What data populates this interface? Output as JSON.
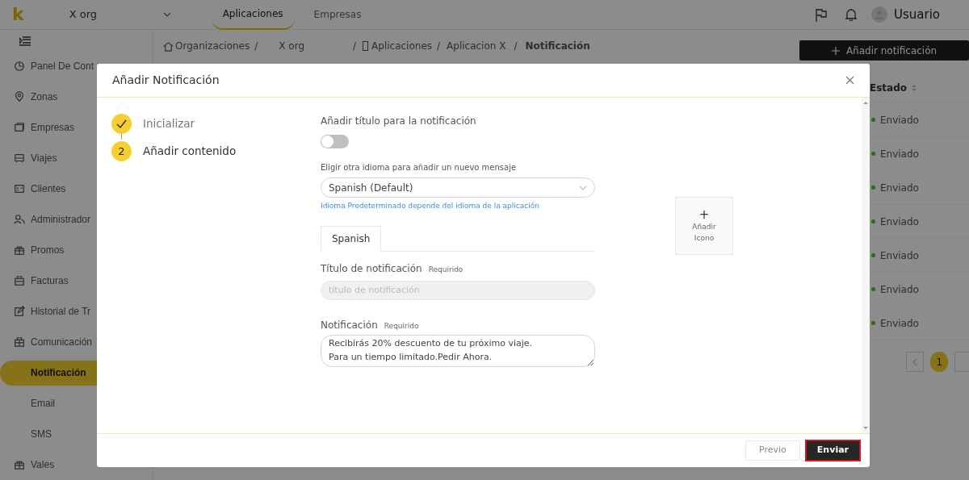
{
  "topbar": {
    "logo": "k",
    "org_select": "X org",
    "tabs": [
      {
        "label": "Aplicaciones",
        "selected": true
      },
      {
        "label": "Empresas",
        "selected": false
      }
    ],
    "user": "Usuario"
  },
  "sidebar": {
    "items": [
      {
        "label": "Panel De Cont",
        "selected": false
      },
      {
        "label": "Zonas",
        "selected": false
      },
      {
        "label": "Empresas",
        "selected": false
      },
      {
        "label": "Viajes",
        "selected": false
      },
      {
        "label": "Clientes",
        "selected": false
      },
      {
        "label": "Administrador",
        "selected": false
      },
      {
        "label": "Promos",
        "selected": false
      },
      {
        "label": "Facturas",
        "selected": false
      },
      {
        "label": "Historial de Tr",
        "selected": false
      },
      {
        "label": "Comunicación",
        "selected": false,
        "children": [
          {
            "label": "Notificación",
            "selected": true
          },
          {
            "label": "Email",
            "selected": false
          },
          {
            "label": "SMS",
            "selected": false
          }
        ]
      },
      {
        "label": "Vales",
        "selected": false
      }
    ]
  },
  "breadcrumb": [
    "Organizaciones",
    "/",
    "X org",
    "/",
    "Aplicaciones",
    "/",
    "Aplicacion X",
    "/",
    "Notificación"
  ],
  "add_button": "Añadir notificación",
  "table": {
    "columns": [
      "Estado"
    ],
    "rows": [
      {
        "status": "Enviado",
        "color": "#2d6c0e"
      },
      {
        "status": "Enviado",
        "color": "#2d6c0e"
      },
      {
        "status": "Enviado",
        "color": "#2d6c0e"
      },
      {
        "status": "Enviado",
        "color": "#2d6c0e"
      },
      {
        "status": "Enviado",
        "color": "#2d6c0e"
      },
      {
        "status": "Enviado",
        "color": "#2d6c0e"
      },
      {
        "status": "Enviado",
        "color": "#2d6c0e"
      }
    ]
  },
  "pagination": {
    "pages": [
      {
        "label": "1",
        "selected": true
      }
    ]
  },
  "modal": {
    "title": "Añadir Notificación",
    "steps": [
      {
        "label": "Inicializar",
        "completed": true
      },
      {
        "number": "2",
        "label": "Añadir contenido",
        "completed": false
      }
    ],
    "title_toggle": {
      "label": "Añadir título para la notificación",
      "on": false
    },
    "language": {
      "label": "Eligir otra idioma para añadir un nuevo mensaje",
      "value": "Spanish (Default)",
      "hint": "Idioma Predeterminado depende del idioma de la aplicación"
    },
    "language_tabs": [
      {
        "label": "Spanish",
        "selected": true
      }
    ],
    "title_field": {
      "label": "Título de notificación",
      "required": "Requirido",
      "placeholder": "título de notificación",
      "disabled": true
    },
    "message_field": {
      "label": "Notificación",
      "required": "Requirido",
      "value": "Recibirás 20% descuento de tu próximo viaje.\nPara un tiempo limitado.Pedir Ahora."
    },
    "icon_upload": {
      "plus": "+",
      "label": "Añadir Icono"
    },
    "buttons": [
      {
        "label": "Previo",
        "kind": "secondary"
      },
      {
        "label": "Enviar",
        "kind": "primary"
      }
    ]
  }
}
